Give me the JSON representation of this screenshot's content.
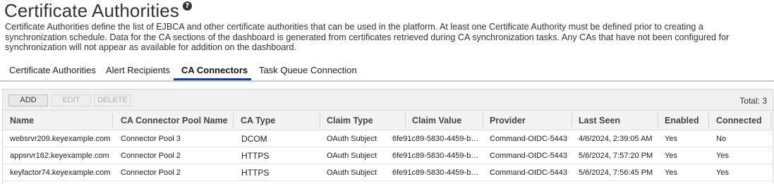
{
  "page": {
    "title": "Certificate Authorities",
    "help_icon": "question-circle-icon",
    "description": "Certificate Authorities define the list of EJBCA and other certificate authorities that can be used in the platform. At least one Certificate Authority must be defined prior to creating a synchronization schedule. Data for the CA sections of the dashboard is generated from certificates retrieved during CA synchronization tasks. Any CAs that have not been configured for synchronization will not appear as available for addition on the dashboard."
  },
  "tabs": [
    {
      "label": "Certificate Authorities",
      "active": false
    },
    {
      "label": "Alert Recipients",
      "active": false
    },
    {
      "label": "CA Connectors",
      "active": true
    },
    {
      "label": "Task Queue Connection",
      "active": false
    }
  ],
  "toolbar": {
    "add_label": "ADD",
    "edit_label": "EDIT",
    "delete_label": "DELETE",
    "total_label": "Total: 3"
  },
  "columns": [
    "Name",
    "CA Connector Pool Name",
    "CA Type",
    "Claim Type",
    "Claim Value",
    "Provider",
    "Last Seen",
    "Enabled",
    "Connected"
  ],
  "rows": [
    [
      "websrvr209.keyexample.com",
      "Connector Pool 3",
      "DCOM",
      "OAuth Subject",
      "6fe91c89-5830-4459-b…",
      "Command-OIDC-5443",
      "4/6/2024, 2:39:05 AM",
      "Yes",
      "No"
    ],
    [
      "appsrvr162.keyexample.com",
      "Connector Pool 2",
      "HTTPS",
      "OAuth Subject",
      "6fe91c89-5830-4459-b…",
      "Command-OIDC-5443",
      "5/6/2024, 7:57:20 PM",
      "Yes",
      "Yes"
    ],
    [
      "keyfactor74.keyexample.com",
      "Connector Pool 2",
      "HTTPS",
      "OAuth Subject",
      "6fe91c89-5830-4459-b…",
      "Command-OIDC-5443",
      "5/6/2024, 7:56:45 PM",
      "Yes",
      "Yes"
    ]
  ],
  "colors": {
    "active_tab_underline": "#1a3fa8",
    "toolbar_bg": "#f0f0f0"
  }
}
